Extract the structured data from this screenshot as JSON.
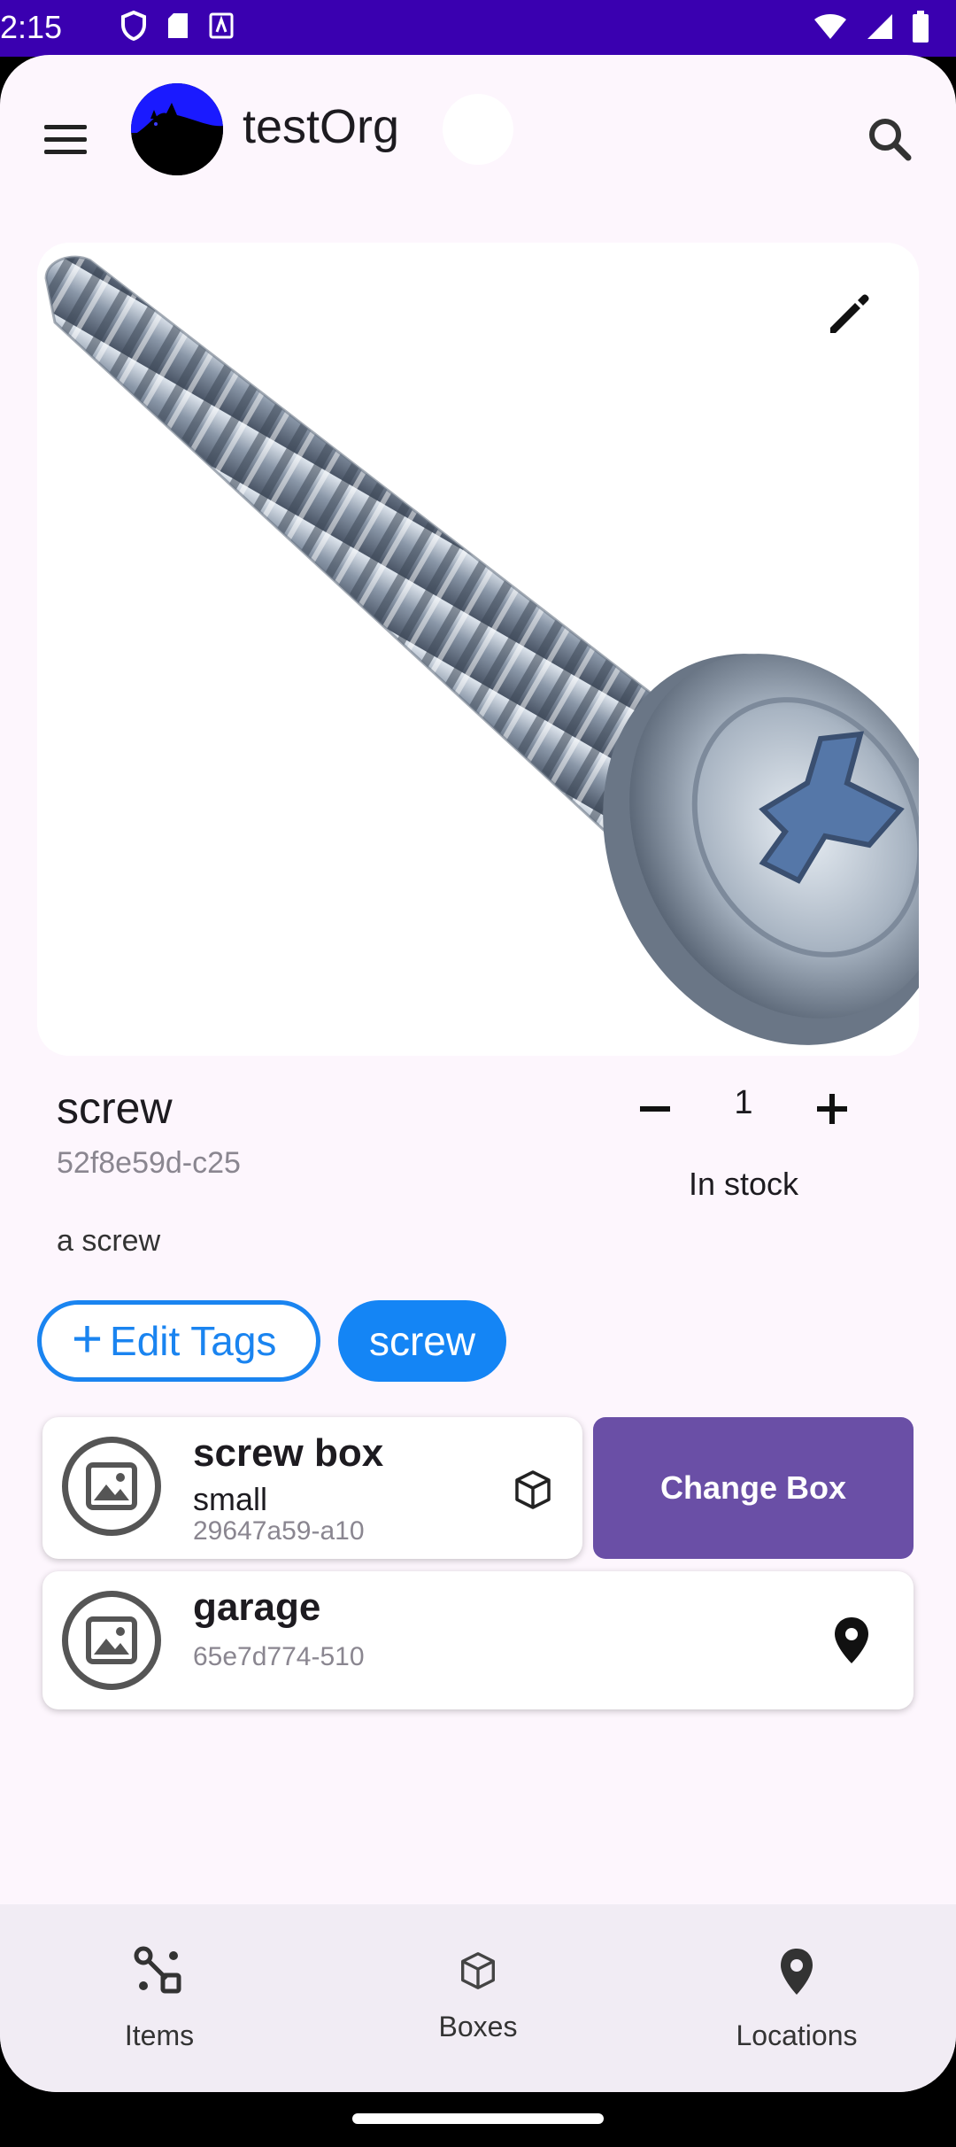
{
  "status_bar": {
    "time": "2:15"
  },
  "app_bar": {
    "org_name": "testOrg"
  },
  "item": {
    "name": "screw",
    "id": "52f8e59d-c25",
    "description": "a screw",
    "quantity": "1",
    "stock_status": "In stock"
  },
  "tags": {
    "edit_label": "Edit Tags",
    "chips": [
      "screw"
    ]
  },
  "box": {
    "name": "screw box",
    "size": "small",
    "id": "29647a59-a10",
    "change_label": "Change Box"
  },
  "location": {
    "name": "garage",
    "id": "65e7d774-510"
  },
  "nav": {
    "items": [
      {
        "label": "Items",
        "icon": "items-icon"
      },
      {
        "label": "Boxes",
        "icon": "box-icon"
      },
      {
        "label": "Locations",
        "icon": "location-pin-icon"
      }
    ]
  },
  "colors": {
    "status_bar": "#3a00b0",
    "accent_blue": "#1485f5",
    "change_box": "#6a4fa6",
    "surface": "#fdf6fd"
  }
}
